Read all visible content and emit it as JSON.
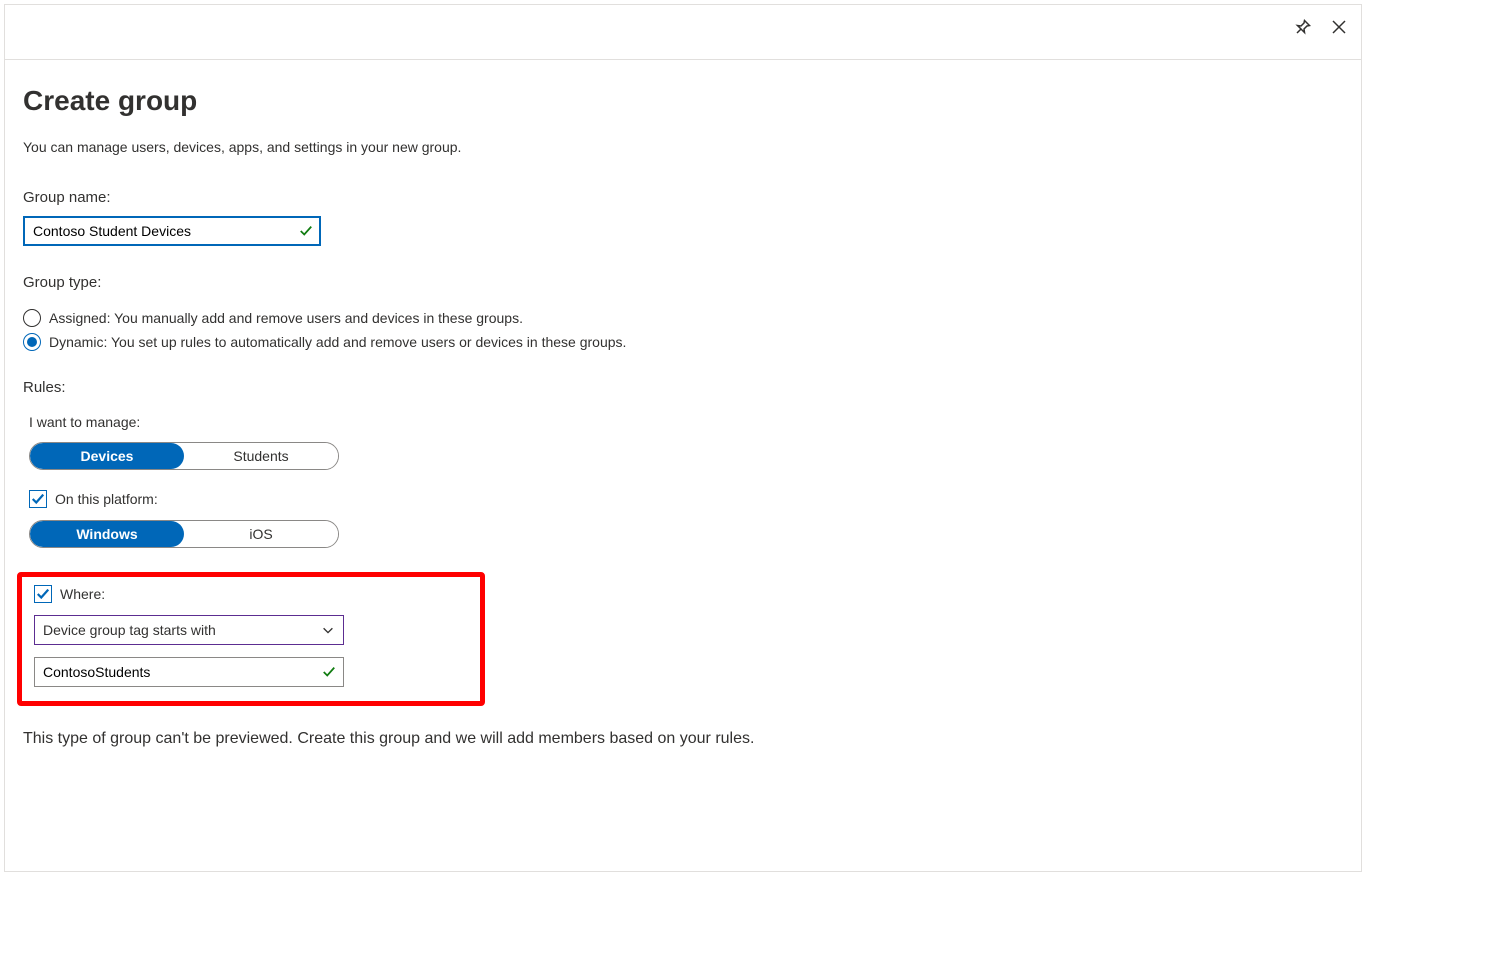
{
  "title": "Create group",
  "subtitle": "You can manage users, devices, apps, and settings in your new group.",
  "group_name": {
    "label": "Group name:",
    "value": "Contoso Student Devices"
  },
  "group_type": {
    "label": "Group type:",
    "options": {
      "assigned": "Assigned: You manually add and remove users and devices in these groups.",
      "dynamic": "Dynamic: You set up rules to automatically add and remove users or devices in these groups."
    },
    "selected": "dynamic"
  },
  "rules": {
    "label": "Rules:",
    "manage": {
      "label": "I want to manage:",
      "options": {
        "devices": "Devices",
        "students": "Students"
      },
      "selected": "devices"
    },
    "platform": {
      "label": "On this platform:",
      "checked": true,
      "options": {
        "windows": "Windows",
        "ios": "iOS"
      },
      "selected": "windows"
    },
    "where": {
      "label": "Where:",
      "checked": true,
      "condition": "Device group tag starts with",
      "value": "ContosoStudents"
    }
  },
  "footer": "This type of group can't be previewed. Create this group and we will add members based on your rules."
}
